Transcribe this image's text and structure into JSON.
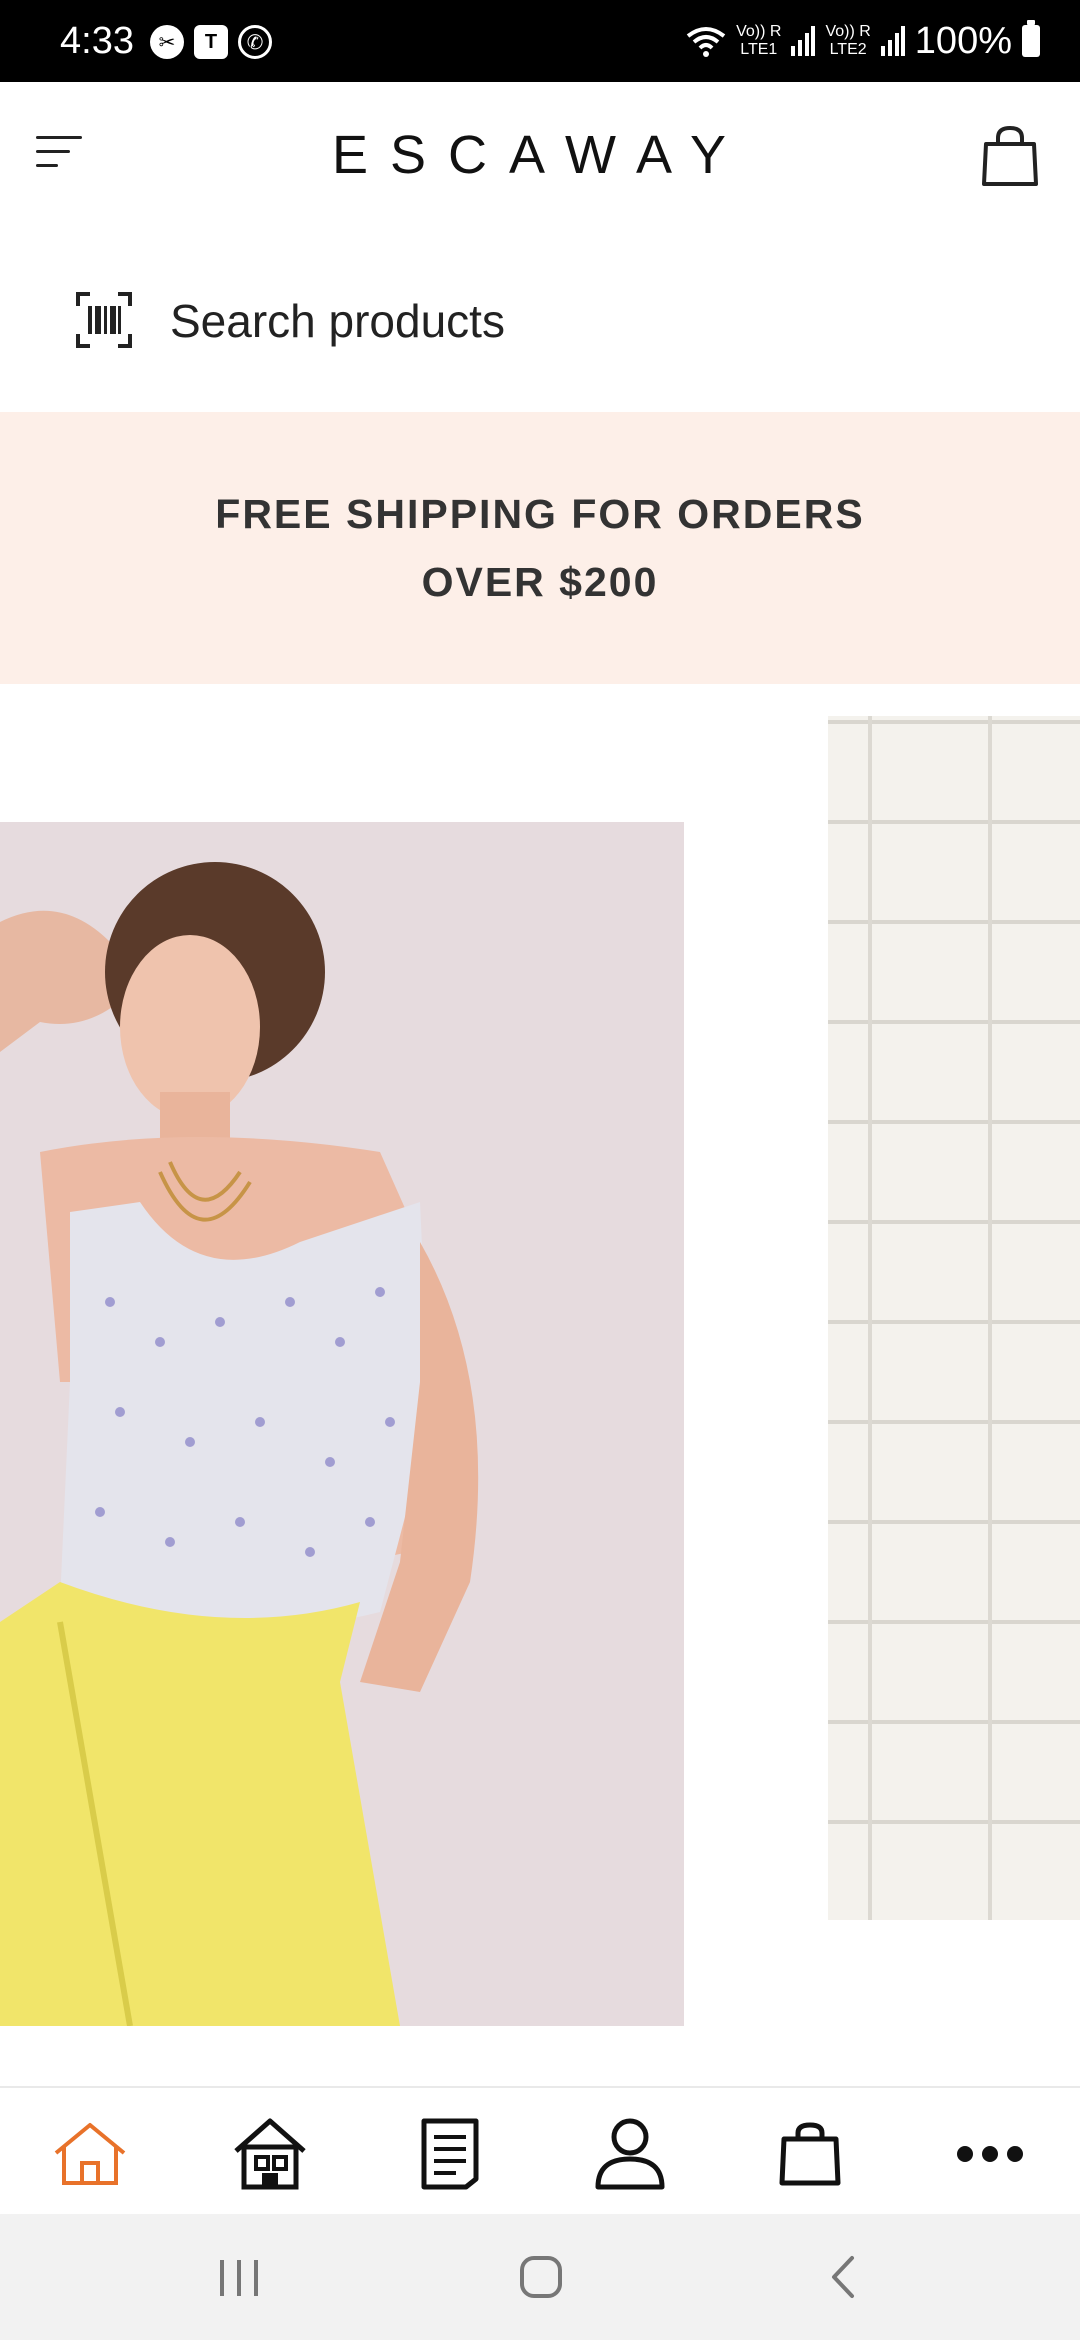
{
  "status_bar": {
    "time": "4:33",
    "left_icons": [
      "notification-icon",
      "teams-icon",
      "whatsapp-icon"
    ],
    "sim1": {
      "top": "Vo)) R",
      "bottom": "LTE1"
    },
    "sim2": {
      "top": "Vo)) R",
      "bottom": "LTE2"
    },
    "battery": "100%"
  },
  "header": {
    "brand": "ESCAWAY",
    "menu_icon": "hamburger-menu-icon",
    "cart_icon": "shopping-bag-icon"
  },
  "search": {
    "placeholder": "Search products",
    "icon": "barcode-scan-icon"
  },
  "banner": {
    "text": "FREE SHIPPING FOR ORDERS\nOVER $200",
    "background": "#fdefe8"
  },
  "bottom_nav": {
    "active_color": "#e8722a",
    "items": [
      {
        "icon": "home-outline-icon",
        "active": true
      },
      {
        "icon": "store-icon",
        "active": false
      },
      {
        "icon": "document-icon",
        "active": false
      },
      {
        "icon": "account-icon",
        "active": false
      },
      {
        "icon": "shopping-bag-icon",
        "active": false
      },
      {
        "icon": "more-icon",
        "active": false
      }
    ]
  },
  "system_nav": [
    "recent-apps-icon",
    "home-icon",
    "back-icon"
  ]
}
